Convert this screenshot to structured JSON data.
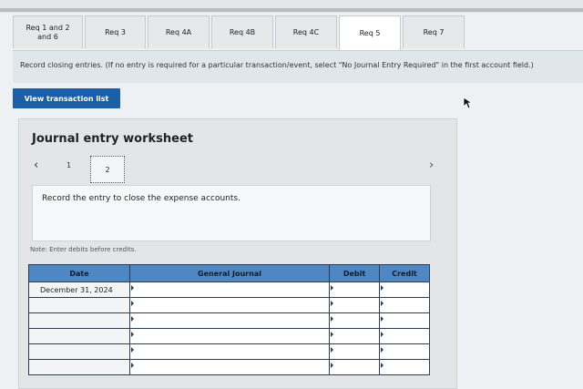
{
  "tabs": [
    {
      "label": "Req 1 and 2\nand 6",
      "active": false
    },
    {
      "label": "Req 3",
      "active": false
    },
    {
      "label": "Req 4A",
      "active": false
    },
    {
      "label": "Req 4B",
      "active": false
    },
    {
      "label": "Req 4C",
      "active": false
    },
    {
      "label": "Req 5",
      "active": true
    },
    {
      "label": "Req 7",
      "active": false
    }
  ],
  "instructions": "Record closing entries. (If no entry is required for a particular transaction/event, select \"No Journal Entry Required\" in the first account field.)",
  "view_transaction_button": "View transaction list",
  "worksheet": {
    "title": "Journal entry worksheet",
    "pages": [
      "1",
      "2"
    ],
    "current_page": "2",
    "entry_description": "Record the entry to close the expense accounts.",
    "note": "Note: Enter debits before credits."
  },
  "journal": {
    "headers": {
      "date": "Date",
      "general_journal": "General Journal",
      "debit": "Debit",
      "credit": "Credit"
    },
    "rows": [
      {
        "date": "December 31, 2024",
        "account": "",
        "debit": "",
        "credit": ""
      },
      {
        "date": "",
        "account": "",
        "debit": "",
        "credit": ""
      },
      {
        "date": "",
        "account": "",
        "debit": "",
        "credit": ""
      },
      {
        "date": "",
        "account": "",
        "debit": "",
        "credit": ""
      },
      {
        "date": "",
        "account": "",
        "debit": "",
        "credit": ""
      },
      {
        "date": "",
        "account": "",
        "debit": "",
        "credit": ""
      }
    ]
  },
  "icons": {
    "prev": "chevron-left-icon",
    "next": "chevron-right-icon",
    "cursor": "mouse-pointer-icon"
  },
  "colors": {
    "button": "#1b5fa8",
    "table_header": "#4f87c5",
    "instruction_bg": "#dfe7ea"
  }
}
